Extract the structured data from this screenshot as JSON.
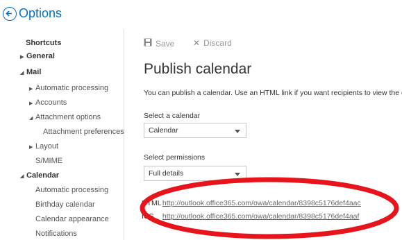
{
  "header": {
    "title": "Options"
  },
  "sidebar": {
    "shortcuts": "Shortcuts",
    "general": "General",
    "mail": "Mail",
    "automatic_processing": "Automatic processing",
    "accounts": "Accounts",
    "attachment_options": "Attachment options",
    "attachment_preferences": "Attachment preferences",
    "layout": "Layout",
    "smime": "S/MIME",
    "calendar": "Calendar",
    "cal_automatic_processing": "Automatic processing",
    "birthday_calendar": "Birthday calendar",
    "calendar_appearance": "Calendar appearance",
    "notifications": "Notifications"
  },
  "toolbar": {
    "save_label": "Save",
    "discard_label": "Discard"
  },
  "main": {
    "title": "Publish calendar",
    "description": "You can publish a calendar. Use an HTML link if you want recipients to view the c",
    "select_calendar_label": "Select a calendar",
    "select_calendar_value": "Calendar",
    "select_permissions_label": "Select permissions",
    "select_permissions_value": "Full details",
    "html_tag": "HTML",
    "html_url": "http://outlook.office365.com/owa/calendar/8398c5176def4aac",
    "ics_tag": "ICS",
    "ics_url": "http://outlook.office365.com/owa/calendar/8398c5176def4aaf"
  },
  "colors": {
    "accent": "#0072c6",
    "annotation": "#e8141b"
  },
  "icons": {
    "back": "back-arrow-icon",
    "save": "save-icon",
    "discard": "close-icon"
  }
}
